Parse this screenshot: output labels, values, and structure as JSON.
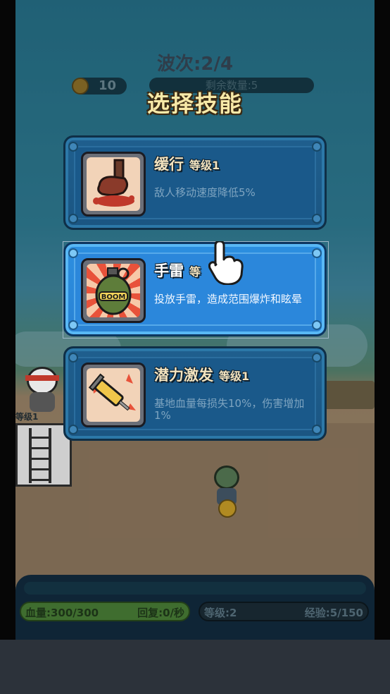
{
  "hud": {
    "wave": "波次:2/4",
    "coins": "10",
    "remaining": "剩余数量:5",
    "hp_label": "血量:300/300",
    "regen_label": "回复:0/秒",
    "level_label": "等级:2",
    "exp_label": "经验:5/150",
    "tower_level": "等级1"
  },
  "dialog": {
    "title": "选择技能",
    "cards": [
      {
        "name": "缓行",
        "level": "等级1",
        "desc": "敌人移动速度降低5%",
        "icon": "boot-slow-icon",
        "selected": false
      },
      {
        "name": "手雷",
        "level": "等",
        "desc": "投放手雷，造成范围爆炸和眩晕",
        "icon": "grenade-icon",
        "selected": true
      },
      {
        "name": "潜力激发",
        "level": "等级1",
        "desc": "基地血量每损失10%，伤害增加1%",
        "icon": "syringe-icon",
        "selected": false
      }
    ]
  },
  "colors": {
    "accent": "#2b87db",
    "title": "#f7e9a8",
    "card": "#1a598a"
  }
}
